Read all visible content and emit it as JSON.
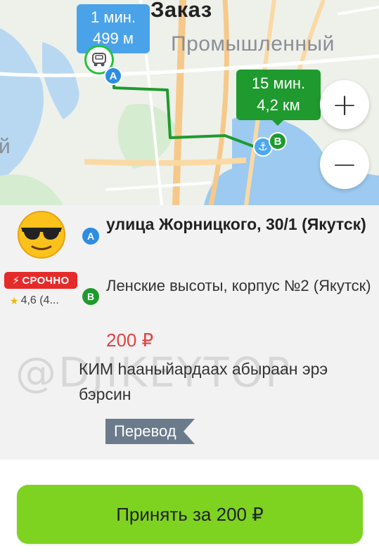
{
  "map": {
    "title": "Заказ",
    "district_label": "Промышленный",
    "edge_label": "й",
    "point_a_bubble": {
      "time": "1 мин.",
      "distance": "499 м"
    },
    "point_b_bubble": {
      "time": "15 мин.",
      "distance": "4,2 км"
    },
    "pin_a": "A",
    "pin_b": "B",
    "zoom_in": "+",
    "zoom_out": "−",
    "icons": [
      "car-icon",
      "anchor-icon"
    ],
    "colors": {
      "route": "#1f9a2e",
      "pin_a": "#2d8de0",
      "pin_b": "#1f9a2e",
      "bubble_a": "#4aa3e8"
    }
  },
  "order": {
    "customer_avatar": "sunglasses-emoji",
    "urgent_badge": "СРОЧНО",
    "rating": "4,6 (4...",
    "from_marker": "A",
    "to_marker": "B",
    "from_address": "улица Жорницкого, 30/1 (Якутск)",
    "to_address": "Ленские высоты, корпус №2 (Якутск)",
    "price": "200 ₽",
    "comment": "КИМ һааныйардаах абыраан эрэ бэрсин",
    "watermark": "@DJIKEYTOP",
    "payment_method": "Перевод",
    "colors": {
      "price": "#e34343",
      "urgent": "#e52a2a",
      "payment_tag": "#6b7b8c"
    }
  },
  "actions": {
    "accept_label": "Принять за 200 ₽",
    "accept_color": "#7ed321"
  }
}
